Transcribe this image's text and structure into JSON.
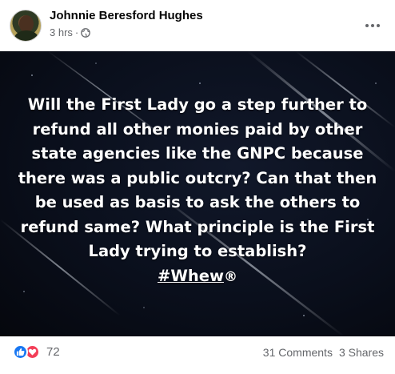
{
  "post": {
    "author": "Johnnie Beresford Hughes",
    "time": "3 hrs",
    "separator": "·",
    "audience_icon": "globe-icon",
    "more_icon": "more-options-icon"
  },
  "image": {
    "text": "Will the First Lady go a step further to refund all other monies paid by other state agencies like the GNPC because there was a public outcry? Can that then be used as basis to ask the others to refund same? What principle is the First Lady trying to establish?",
    "hashtag": "#Whew",
    "hashtag_suffix": "®"
  },
  "footer": {
    "reaction_icons": [
      "like-icon",
      "love-icon"
    ],
    "reaction_count": "72",
    "comments": "31 Comments",
    "shares": "3 Shares"
  },
  "colors": {
    "like": "#1877f2",
    "love": "#f33e58",
    "secondary_text": "#65676b"
  }
}
